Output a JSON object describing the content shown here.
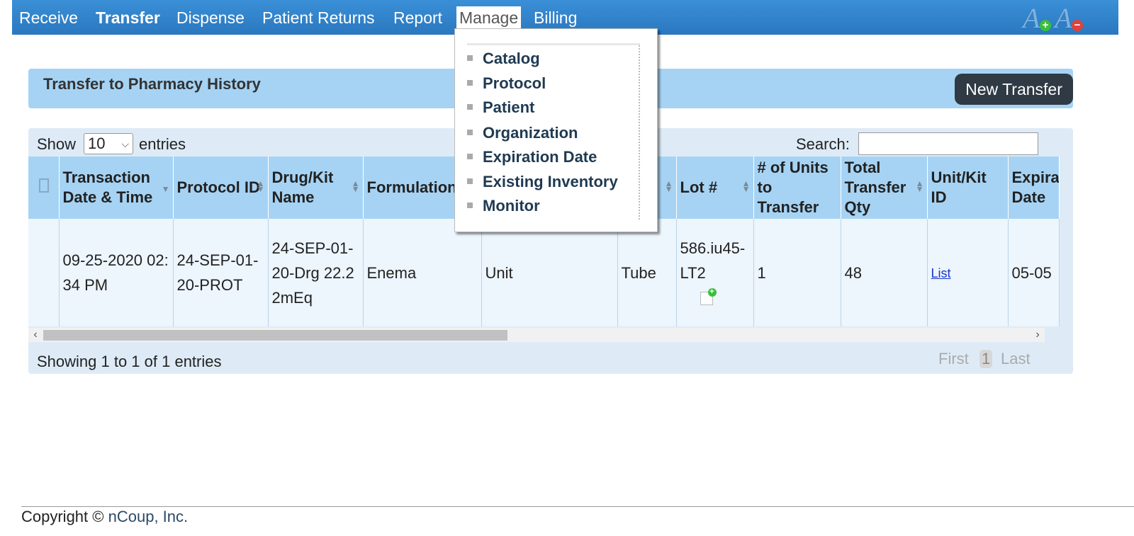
{
  "nav": {
    "items": [
      {
        "label": "Receive"
      },
      {
        "label": "Transfer"
      },
      {
        "label": "Dispense"
      },
      {
        "label": "Patient Returns"
      },
      {
        "label": "Report"
      },
      {
        "label": "Manage"
      },
      {
        "label": "Billing"
      }
    ],
    "active": "Manage",
    "font_increase_icon": "font-increase-icon",
    "font_decrease_icon": "font-decrease-icon",
    "bar_color": "#2a78c0"
  },
  "panel": {
    "title": "Transfer to Pharmacy History",
    "new_button": "New Transfer"
  },
  "table_controls": {
    "show_label": "Show",
    "page_size": "10",
    "entries_label": "entries",
    "search_label": "Search:",
    "search_value": ""
  },
  "table": {
    "headers": [
      "Transaction Date & Time",
      "Protocol ID",
      "Drug/Kit Name",
      "Formulation",
      "",
      "",
      "Lot #",
      "# of Units to Transfer",
      "Total Transfer Qty",
      "Unit/Kit ID",
      "Expiration Date"
    ],
    "rows": [
      {
        "date": "09-25-2020 02:34 PM",
        "protocol": "24-SEP-01-20-PROT",
        "drug": "24-SEP-01-20-Drg 22.22mEq",
        "formulation": "Enema",
        "unit": "Unit",
        "container": "Tube",
        "lot": "586.iu45-LT2",
        "units_to_transfer": "1",
        "total_qty": "48",
        "kit_id": "List",
        "expiration": "05-05"
      }
    ]
  },
  "footer_info": {
    "showing": "Showing 1 to 1 of 1 entries",
    "first": "First",
    "page": "1",
    "last": "Last"
  },
  "manage_menu": {
    "items": [
      "Catalog",
      "Protocol",
      "Patient",
      "Organization",
      "Expiration Date",
      "Existing Inventory",
      "Monitor"
    ]
  },
  "footer": {
    "copyright": "Copyright ©",
    "company": "nCoup, Inc."
  }
}
